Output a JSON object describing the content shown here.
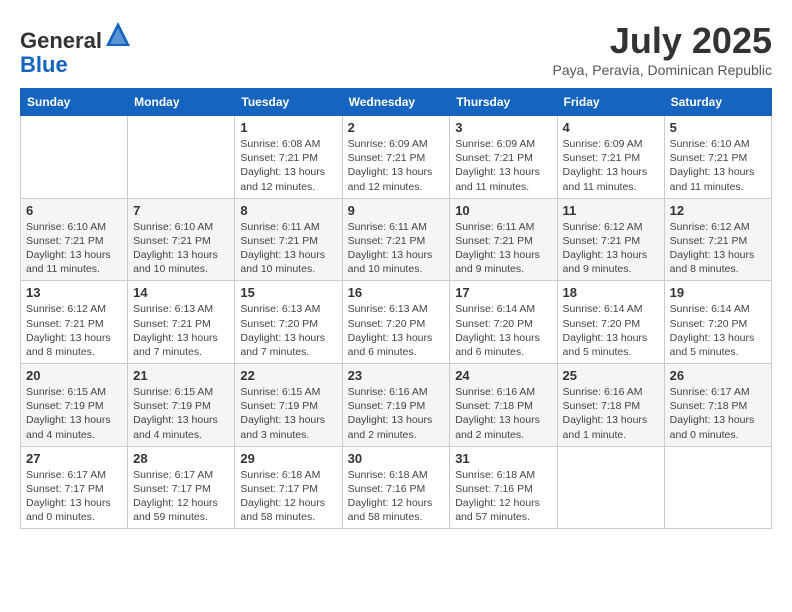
{
  "header": {
    "logo_general": "General",
    "logo_blue": "Blue",
    "month_title": "July 2025",
    "location": "Paya, Peravia, Dominican Republic"
  },
  "days_of_week": [
    "Sunday",
    "Monday",
    "Tuesday",
    "Wednesday",
    "Thursday",
    "Friday",
    "Saturday"
  ],
  "weeks": [
    [
      {
        "day": "",
        "info": ""
      },
      {
        "day": "",
        "info": ""
      },
      {
        "day": "1",
        "info": "Sunrise: 6:08 AM\nSunset: 7:21 PM\nDaylight: 13 hours\nand 12 minutes."
      },
      {
        "day": "2",
        "info": "Sunrise: 6:09 AM\nSunset: 7:21 PM\nDaylight: 13 hours\nand 12 minutes."
      },
      {
        "day": "3",
        "info": "Sunrise: 6:09 AM\nSunset: 7:21 PM\nDaylight: 13 hours\nand 11 minutes."
      },
      {
        "day": "4",
        "info": "Sunrise: 6:09 AM\nSunset: 7:21 PM\nDaylight: 13 hours\nand 11 minutes."
      },
      {
        "day": "5",
        "info": "Sunrise: 6:10 AM\nSunset: 7:21 PM\nDaylight: 13 hours\nand 11 minutes."
      }
    ],
    [
      {
        "day": "6",
        "info": "Sunrise: 6:10 AM\nSunset: 7:21 PM\nDaylight: 13 hours\nand 11 minutes."
      },
      {
        "day": "7",
        "info": "Sunrise: 6:10 AM\nSunset: 7:21 PM\nDaylight: 13 hours\nand 10 minutes."
      },
      {
        "day": "8",
        "info": "Sunrise: 6:11 AM\nSunset: 7:21 PM\nDaylight: 13 hours\nand 10 minutes."
      },
      {
        "day": "9",
        "info": "Sunrise: 6:11 AM\nSunset: 7:21 PM\nDaylight: 13 hours\nand 10 minutes."
      },
      {
        "day": "10",
        "info": "Sunrise: 6:11 AM\nSunset: 7:21 PM\nDaylight: 13 hours\nand 9 minutes."
      },
      {
        "day": "11",
        "info": "Sunrise: 6:12 AM\nSunset: 7:21 PM\nDaylight: 13 hours\nand 9 minutes."
      },
      {
        "day": "12",
        "info": "Sunrise: 6:12 AM\nSunset: 7:21 PM\nDaylight: 13 hours\nand 8 minutes."
      }
    ],
    [
      {
        "day": "13",
        "info": "Sunrise: 6:12 AM\nSunset: 7:21 PM\nDaylight: 13 hours\nand 8 minutes."
      },
      {
        "day": "14",
        "info": "Sunrise: 6:13 AM\nSunset: 7:21 PM\nDaylight: 13 hours\nand 7 minutes."
      },
      {
        "day": "15",
        "info": "Sunrise: 6:13 AM\nSunset: 7:20 PM\nDaylight: 13 hours\nand 7 minutes."
      },
      {
        "day": "16",
        "info": "Sunrise: 6:13 AM\nSunset: 7:20 PM\nDaylight: 13 hours\nand 6 minutes."
      },
      {
        "day": "17",
        "info": "Sunrise: 6:14 AM\nSunset: 7:20 PM\nDaylight: 13 hours\nand 6 minutes."
      },
      {
        "day": "18",
        "info": "Sunrise: 6:14 AM\nSunset: 7:20 PM\nDaylight: 13 hours\nand 5 minutes."
      },
      {
        "day": "19",
        "info": "Sunrise: 6:14 AM\nSunset: 7:20 PM\nDaylight: 13 hours\nand 5 minutes."
      }
    ],
    [
      {
        "day": "20",
        "info": "Sunrise: 6:15 AM\nSunset: 7:19 PM\nDaylight: 13 hours\nand 4 minutes."
      },
      {
        "day": "21",
        "info": "Sunrise: 6:15 AM\nSunset: 7:19 PM\nDaylight: 13 hours\nand 4 minutes."
      },
      {
        "day": "22",
        "info": "Sunrise: 6:15 AM\nSunset: 7:19 PM\nDaylight: 13 hours\nand 3 minutes."
      },
      {
        "day": "23",
        "info": "Sunrise: 6:16 AM\nSunset: 7:19 PM\nDaylight: 13 hours\nand 2 minutes."
      },
      {
        "day": "24",
        "info": "Sunrise: 6:16 AM\nSunset: 7:18 PM\nDaylight: 13 hours\nand 2 minutes."
      },
      {
        "day": "25",
        "info": "Sunrise: 6:16 AM\nSunset: 7:18 PM\nDaylight: 13 hours\nand 1 minute."
      },
      {
        "day": "26",
        "info": "Sunrise: 6:17 AM\nSunset: 7:18 PM\nDaylight: 13 hours\nand 0 minutes."
      }
    ],
    [
      {
        "day": "27",
        "info": "Sunrise: 6:17 AM\nSunset: 7:17 PM\nDaylight: 13 hours\nand 0 minutes."
      },
      {
        "day": "28",
        "info": "Sunrise: 6:17 AM\nSunset: 7:17 PM\nDaylight: 12 hours\nand 59 minutes."
      },
      {
        "day": "29",
        "info": "Sunrise: 6:18 AM\nSunset: 7:17 PM\nDaylight: 12 hours\nand 58 minutes."
      },
      {
        "day": "30",
        "info": "Sunrise: 6:18 AM\nSunset: 7:16 PM\nDaylight: 12 hours\nand 58 minutes."
      },
      {
        "day": "31",
        "info": "Sunrise: 6:18 AM\nSunset: 7:16 PM\nDaylight: 12 hours\nand 57 minutes."
      },
      {
        "day": "",
        "info": ""
      },
      {
        "day": "",
        "info": ""
      }
    ]
  ]
}
